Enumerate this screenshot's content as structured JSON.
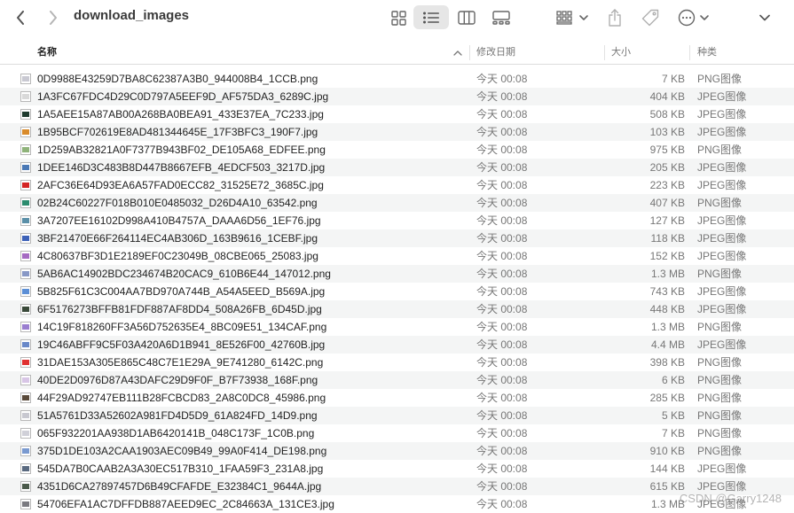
{
  "window": {
    "title": "download_images",
    "icons": {
      "back": "chevron-left-icon",
      "forward": "chevron-right-icon",
      "view_icons": "grid-icon",
      "view_list": "list-icon",
      "view_columns": "columns-icon",
      "view_gallery": "gallery-icon",
      "group": "group-icon",
      "share": "share-icon",
      "tag": "tag-icon",
      "more": "ellipsis-circle-icon",
      "expand": "chevron-down-icon"
    }
  },
  "columns": {
    "name": "名称",
    "date": "修改日期",
    "size": "大小",
    "kind": "种类"
  },
  "files": [
    {
      "name": "0D9988E43259D7BA8C62387A3B0_944008B4_1CCB.png",
      "date": "今天 00:08",
      "size": "7 KB",
      "kind": "PNG图像",
      "thumb": "#c9c9d2"
    },
    {
      "name": "1A3FC67FDC4D29C0D797A5EEF9D_AF575DA3_6289C.jpg",
      "date": "今天 00:08",
      "size": "404 KB",
      "kind": "JPEG图像",
      "thumb": "#d9d9d9"
    },
    {
      "name": "1A5AEE15A87AB00A268BA0BEA91_433E37EA_7C233.jpg",
      "date": "今天 00:08",
      "size": "508 KB",
      "kind": "JPEG图像",
      "thumb": "#1f3b2e"
    },
    {
      "name": "1B95BCF702619E8AD481344645E_17F3BFC3_190F7.jpg",
      "date": "今天 00:08",
      "size": "103 KB",
      "kind": "JPEG图像",
      "thumb": "#d98b2b"
    },
    {
      "name": "1D259AB32821A0F7377B943BF02_DE105A68_EDFEE.png",
      "date": "今天 00:08",
      "size": "975 KB",
      "kind": "PNG图像",
      "thumb": "#8fb37a"
    },
    {
      "name": "1DEE146D3C483B8D447B8667EFB_4EDCF503_3217D.jpg",
      "date": "今天 00:08",
      "size": "205 KB",
      "kind": "JPEG图像",
      "thumb": "#4a78b5"
    },
    {
      "name": "2AFC36E64D93EA6A57FAD0ECC82_31525E72_3685C.jpg",
      "date": "今天 00:08",
      "size": "223 KB",
      "kind": "JPEG图像",
      "thumb": "#d42525"
    },
    {
      "name": "02B24C60227F018B010E0485032_D26D4A10_63542.png",
      "date": "今天 00:08",
      "size": "407 KB",
      "kind": "PNG图像",
      "thumb": "#2c8c6e"
    },
    {
      "name": "3A7207EE16102D998A410B4757A_DAAA6D56_1EF76.jpg",
      "date": "今天 00:08",
      "size": "127 KB",
      "kind": "JPEG图像",
      "thumb": "#5a8fa8"
    },
    {
      "name": "3BF21470E66F264114EC4AB306D_163B9616_1CEBF.jpg",
      "date": "今天 00:08",
      "size": "118 KB",
      "kind": "JPEG图像",
      "thumb": "#3d62b8"
    },
    {
      "name": "4C80637BF3D1E2189EF0C23049B_08CBE065_25083.jpg",
      "date": "今天 00:08",
      "size": "152 KB",
      "kind": "JPEG图像",
      "thumb": "#a56ac2"
    },
    {
      "name": "5AB6AC14902BDC234674B20CAC9_610B6E44_147012.png",
      "date": "今天 00:08",
      "size": "1.3 MB",
      "kind": "PNG图像",
      "thumb": "#8898c6"
    },
    {
      "name": "5B825F61C3C004AA7BD970A744B_A54A5EED_B569A.jpg",
      "date": "今天 00:08",
      "size": "743 KB",
      "kind": "JPEG图像",
      "thumb": "#5c8fd6"
    },
    {
      "name": "6F5176273BFFB81FDF887AF8DD4_508A26FB_6D45D.jpg",
      "date": "今天 00:08",
      "size": "448 KB",
      "kind": "JPEG图像",
      "thumb": "#3a4a3a"
    },
    {
      "name": "14C19F818260FF3A56D752635E4_8BC09E51_134CAF.png",
      "date": "今天 00:08",
      "size": "1.3 MB",
      "kind": "PNG图像",
      "thumb": "#9a7ed0"
    },
    {
      "name": "19C46ABFF9C5F03A420A6D1B941_8E526F00_42760B.jpg",
      "date": "今天 00:08",
      "size": "4.4 MB",
      "kind": "JPEG图像",
      "thumb": "#6a88c8"
    },
    {
      "name": "31DAE153A305E865C48C7E1E29A_9E741280_6142C.png",
      "date": "今天 00:08",
      "size": "398 KB",
      "kind": "PNG图像",
      "thumb": "#e03030"
    },
    {
      "name": "40DE2D0976D87A43DAFC29D9F0F_B7F73938_168F.png",
      "date": "今天 00:08",
      "size": "6 KB",
      "kind": "PNG图像",
      "thumb": "#d8c6e6"
    },
    {
      "name": "44F29AD92747EB111B28FCBCD83_2A8C0DC8_45986.png",
      "date": "今天 00:08",
      "size": "285 KB",
      "kind": "PNG图像",
      "thumb": "#5a4a3a"
    },
    {
      "name": "51A5761D33A52602A981FD4D5D9_61A824FD_14D9.png",
      "date": "今天 00:08",
      "size": "5 KB",
      "kind": "PNG图像",
      "thumb": "#c8c8d0"
    },
    {
      "name": "065F932201AA938D1AB6420141B_048C173F_1C0B.png",
      "date": "今天 00:08",
      "size": "7 KB",
      "kind": "PNG图像",
      "thumb": "#d0d0d8"
    },
    {
      "name": "375D1DE103A2CAA1903AEC09B49_99A0F414_DE198.png",
      "date": "今天 00:08",
      "size": "910 KB",
      "kind": "PNG图像",
      "thumb": "#7a9ad0"
    },
    {
      "name": "545DA7B0CAAB2A3A30EC517B310_1FAA59F3_231A8.jpg",
      "date": "今天 00:08",
      "size": "144 KB",
      "kind": "JPEG图像",
      "thumb": "#5a6a80"
    },
    {
      "name": "4351D6CA27897457D6B49CFAFDE_E32384C1_9644A.jpg",
      "date": "今天 00:08",
      "size": "615 KB",
      "kind": "JPEG图像",
      "thumb": "#4a5a4a"
    },
    {
      "name": "54706EFA1AC7DFFDB887AEED9EC_2C84663A_131CE3.jpg",
      "date": "今天 00:08",
      "size": "1.3 MB",
      "kind": "JPEG图像",
      "thumb": "#7a7a80"
    }
  ],
  "watermark": "CSDN @Garry1248"
}
